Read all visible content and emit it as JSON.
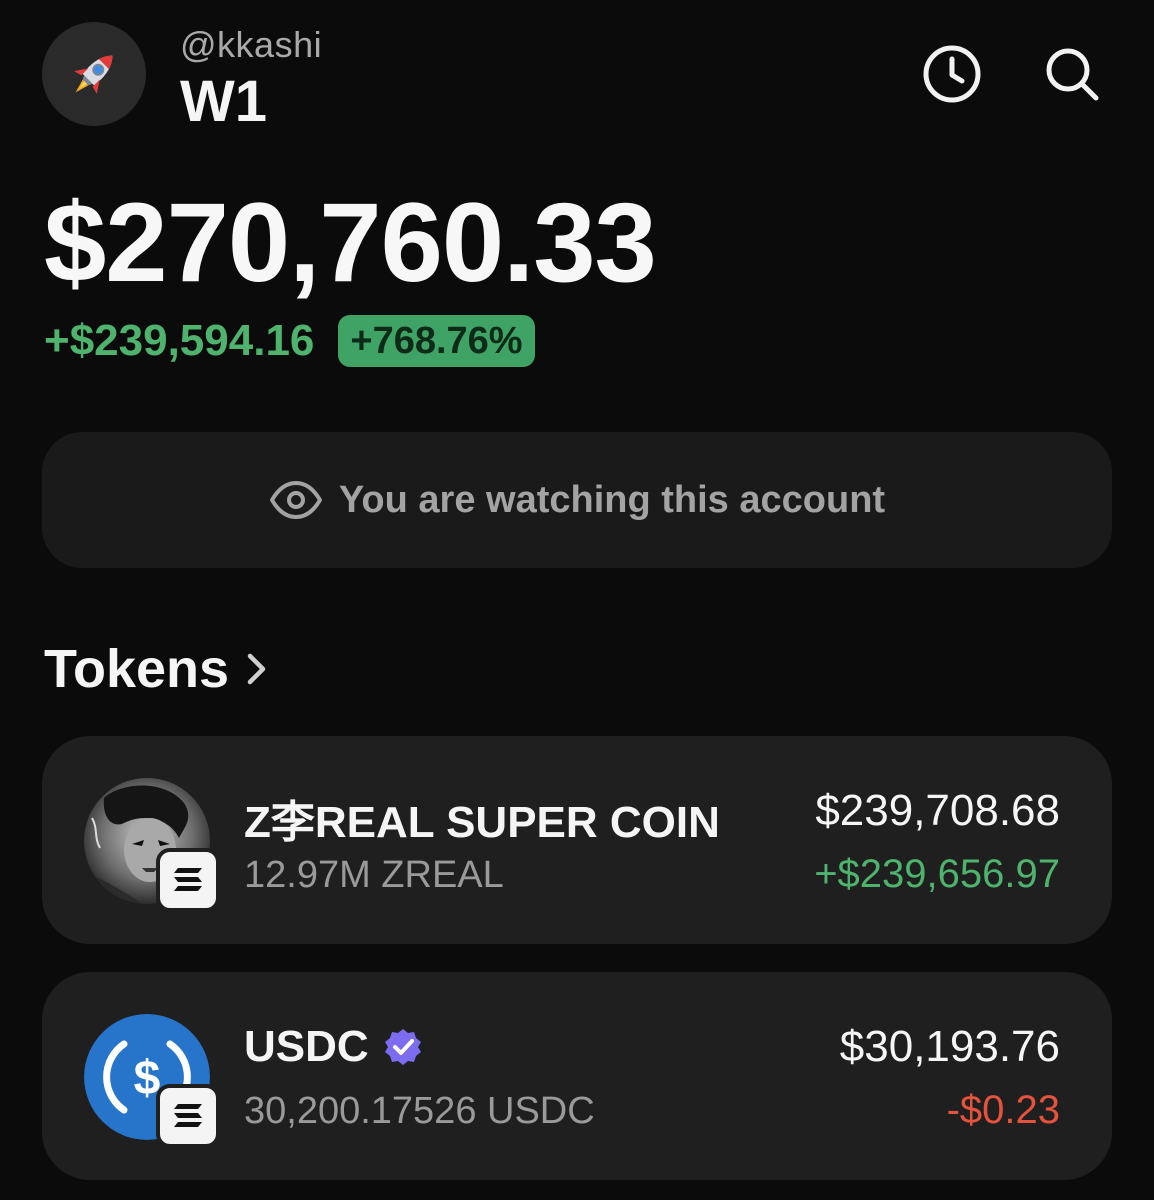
{
  "header": {
    "avatar_icon": "rocket-icon",
    "handle": "@kkashi",
    "wallet_name": "W1",
    "history_icon": "clock-icon",
    "search_icon": "search-icon"
  },
  "portfolio": {
    "balance": "$270,760.33",
    "change_amount": "+$239,594.16",
    "change_percent": "+768.76%"
  },
  "watch_banner": {
    "icon": "eye-icon",
    "text": "You are watching this account"
  },
  "tokens": {
    "title": "Tokens",
    "items": [
      {
        "name": "Z李REAL SUPER COIN",
        "amount": "12.97M ZREAL",
        "value": "$239,708.68",
        "pnl": "+$239,656.97",
        "pnl_direction": "positive",
        "verified": false,
        "chain_icon": "solana-icon"
      },
      {
        "name": "USDC",
        "amount": "30,200.17526 USDC",
        "value": "$30,193.76",
        "pnl": "-$0.23",
        "pnl_direction": "negative",
        "verified": true,
        "chain_icon": "solana-icon"
      }
    ]
  },
  "colors": {
    "background": "#0b0b0b",
    "card": "#1f1f1f",
    "positive": "#4eb46d",
    "negative": "#e5533d",
    "verified": "#7c6cf0",
    "usdc_blue": "#2775ca"
  }
}
